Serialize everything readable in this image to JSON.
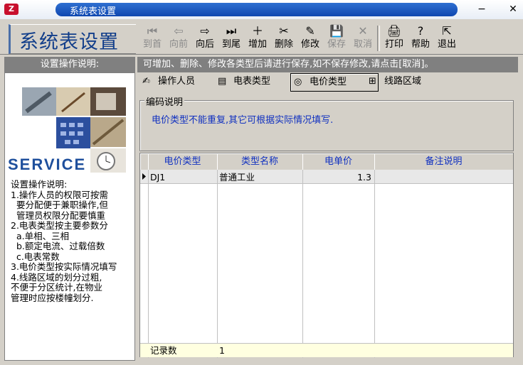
{
  "window": {
    "title": "系统表设置",
    "minimize": "−",
    "close": "✕"
  },
  "header": {
    "big_title": "系统表设置"
  },
  "toolbar": [
    {
      "key": "first",
      "label": "到首",
      "icon": "⏮",
      "enabled": false
    },
    {
      "key": "prev",
      "label": "向前",
      "icon": "⇦",
      "enabled": false
    },
    {
      "key": "next",
      "label": "向后",
      "icon": "⇨",
      "enabled": true
    },
    {
      "key": "last",
      "label": "到尾",
      "icon": "⏭",
      "enabled": true
    },
    {
      "key": "add",
      "label": "增加",
      "icon": "＋",
      "enabled": true
    },
    {
      "key": "delete",
      "label": "删除",
      "icon": "✂",
      "enabled": true
    },
    {
      "key": "edit",
      "label": "修改",
      "icon": "✎",
      "enabled": true
    },
    {
      "key": "save",
      "label": "保存",
      "icon": "💾",
      "enabled": false
    },
    {
      "key": "cancel",
      "label": "取消",
      "icon": "✕",
      "enabled": false
    },
    {
      "key": "print",
      "label": "打印",
      "icon": "🖨",
      "enabled": true
    },
    {
      "key": "help",
      "label": "帮助",
      "icon": "?",
      "enabled": true
    },
    {
      "key": "exit",
      "label": "退出",
      "icon": "⇱",
      "enabled": true
    }
  ],
  "left": {
    "heading": "设置操作说明:",
    "service": "SERVICE",
    "help_text": "设置操作说明:\n1.操作人员的权限可按需\n  要分配便于兼职操作,但\n  管理员权限分配要慎重\n2.电表类型按主要参数分\n  a.单相、三相\n  b.额定电流、过载倍数\n  c.电表常数\n3.电价类型按实际情况填写\n4.线路区域的划分过粗,\n不便于分区统计,在物业\n管理时应按楼幢划分."
  },
  "infobar": "可增加、删除、修改各类型后请进行保存,如不保存修改,请点击[取消]。",
  "tabs": [
    {
      "label": "操作人员",
      "icon": "person-icon",
      "glyph": "✍",
      "active": false
    },
    {
      "label": "电表类型",
      "icon": "meter-icon",
      "glyph": "▤",
      "active": false
    },
    {
      "label": "电价类型",
      "icon": "price-icon",
      "glyph": "◎",
      "active": true
    },
    {
      "label": "线路区域",
      "icon": "network-icon",
      "glyph": "⊞",
      "active": false
    }
  ],
  "group": {
    "legend": "编码说明",
    "description": "电价类型不能重复,其它可根据实际情况填写."
  },
  "grid": {
    "columns": [
      "电价类型",
      "类型名称",
      "电单价",
      "备注说明"
    ],
    "rows": [
      {
        "code": "DJ1",
        "name": "普通工业",
        "price": "1.3",
        "note": ""
      }
    ],
    "footer": {
      "label": "记录数",
      "value": "1"
    }
  }
}
